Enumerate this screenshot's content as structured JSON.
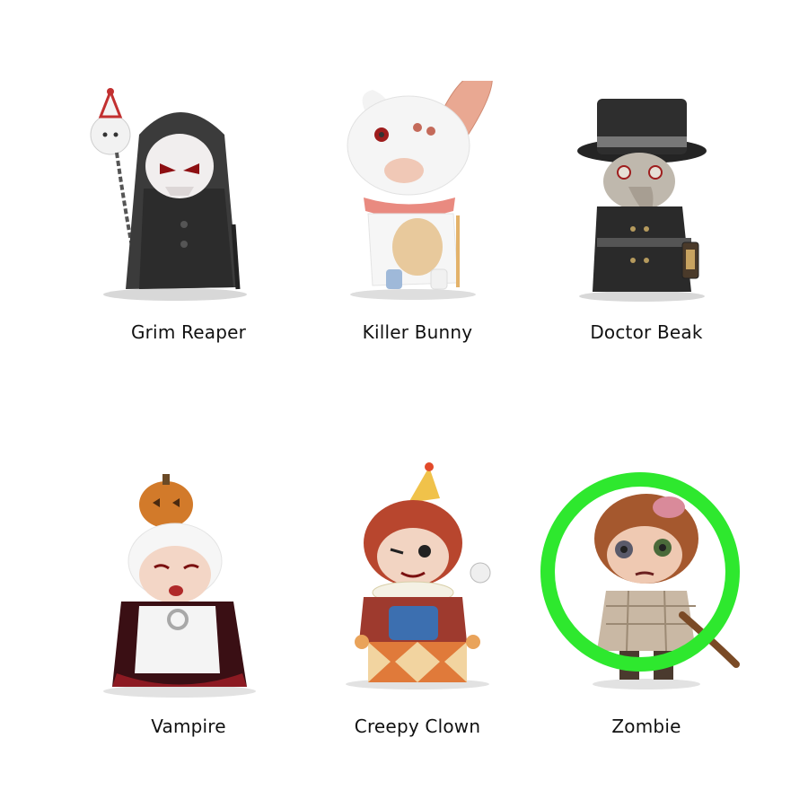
{
  "figures": [
    {
      "name": "Grim Reaper",
      "icon": "grim-reaper-figure"
    },
    {
      "name": "Killer Bunny",
      "icon": "killer-bunny-figure"
    },
    {
      "name": "Doctor Beak",
      "icon": "doctor-beak-figure"
    },
    {
      "name": "Vampire",
      "icon": "vampire-figure"
    },
    {
      "name": "Creepy Clown",
      "icon": "creepy-clown-figure"
    },
    {
      "name": "Zombie",
      "icon": "zombie-figure",
      "highlighted": true
    }
  ],
  "colors": {
    "highlight_ring": "#2ee82e",
    "background": "#ffffff",
    "text": "#111111"
  }
}
